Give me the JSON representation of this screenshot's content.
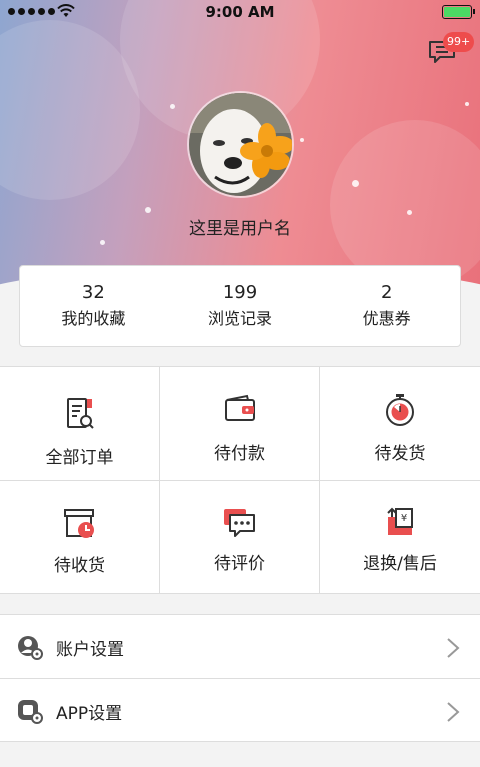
{
  "status_bar": {
    "time": "9:00 AM"
  },
  "colors": {
    "accent": "#e94f4f",
    "badge": "#ee4c4c",
    "battery": "#4cd964"
  },
  "header": {
    "message_badge": "99+",
    "username": "这里是用户名"
  },
  "stats": [
    {
      "value": "32",
      "label": "我的收藏"
    },
    {
      "value": "199",
      "label": "浏览记录"
    },
    {
      "value": "2",
      "label": "优惠券"
    }
  ],
  "orders": [
    {
      "label": "全部订单",
      "icon": "order-list-icon"
    },
    {
      "label": "待付款",
      "icon": "wallet-icon"
    },
    {
      "label": "待发货",
      "icon": "stopwatch-icon"
    },
    {
      "label": "待收货",
      "icon": "box-clock-icon"
    },
    {
      "label": "待评价",
      "icon": "chat-bubble-icon"
    },
    {
      "label": "退换/售后",
      "icon": "return-yen-icon"
    }
  ],
  "menu": [
    {
      "label": "账户设置",
      "icon": "user-settings-icon"
    },
    {
      "label": "APP设置",
      "icon": "app-settings-icon"
    }
  ]
}
